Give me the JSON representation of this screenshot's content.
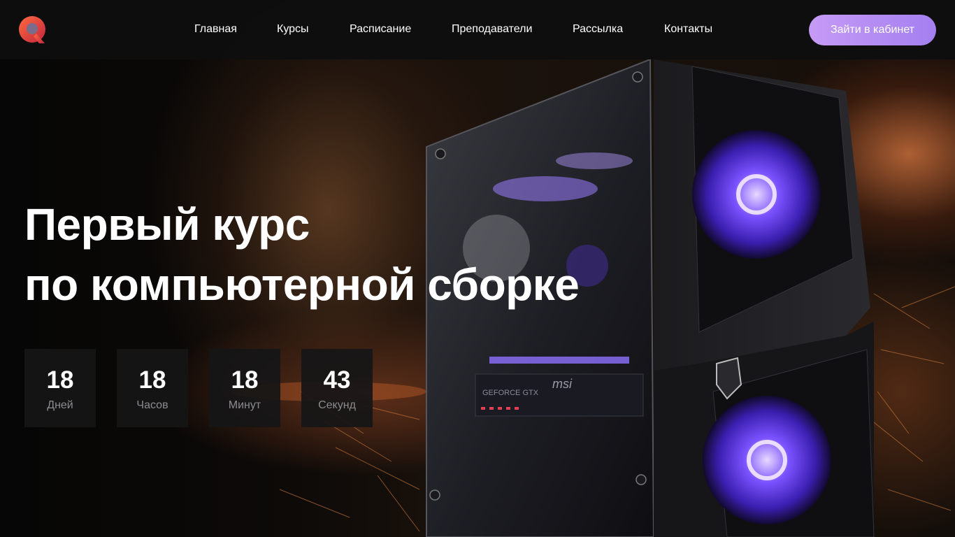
{
  "brand": {
    "logo_icon": "q-logo-icon",
    "accent": "#a47ff0"
  },
  "nav": {
    "items": [
      {
        "label": "Главная"
      },
      {
        "label": "Курсы"
      },
      {
        "label": "Расписание"
      },
      {
        "label": "Преподаватели"
      },
      {
        "label": "Рассылка"
      },
      {
        "label": "Контакты"
      }
    ],
    "cta_label": "Зайти в кабинет"
  },
  "hero": {
    "title_line1": "Первый курс",
    "title_line2": "по компьютерной сборке"
  },
  "countdown": [
    {
      "value": "18",
      "label": "Дней"
    },
    {
      "value": "18",
      "label": "Часов"
    },
    {
      "value": "18",
      "label": "Минут"
    },
    {
      "value": "43",
      "label": "Секунд"
    }
  ],
  "case_badges": {
    "gpu_text": "GEFORCE GTX",
    "brand_text": "msi"
  }
}
